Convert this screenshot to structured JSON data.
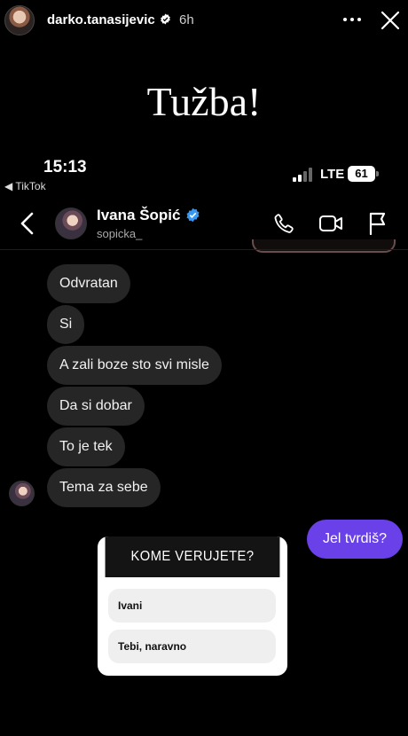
{
  "story": {
    "username": "darko.tanasijevic",
    "time": "6h",
    "caption": "Tužba!"
  },
  "status_bar": {
    "time": "15:13",
    "back_app": "◀ TikTok",
    "network": "LTE",
    "battery": "61"
  },
  "chat": {
    "contact_name": "Ivana Šopić",
    "contact_handle": "sopicka_",
    "messages_in": [
      "Odvratan",
      "Si",
      "A zali boze sto svi misle",
      "Da si dobar",
      "To je tek",
      "Tema za sebe"
    ],
    "message_out": "Jel tvrdiš?"
  },
  "poll": {
    "question": "KOME VERUJETE?",
    "options": [
      "Ivani",
      "Tebi, naravno"
    ]
  },
  "colors": {
    "sent_bubble": "#6a41e8",
    "received_bubble": "#262626",
    "verified": "#3897f0"
  }
}
